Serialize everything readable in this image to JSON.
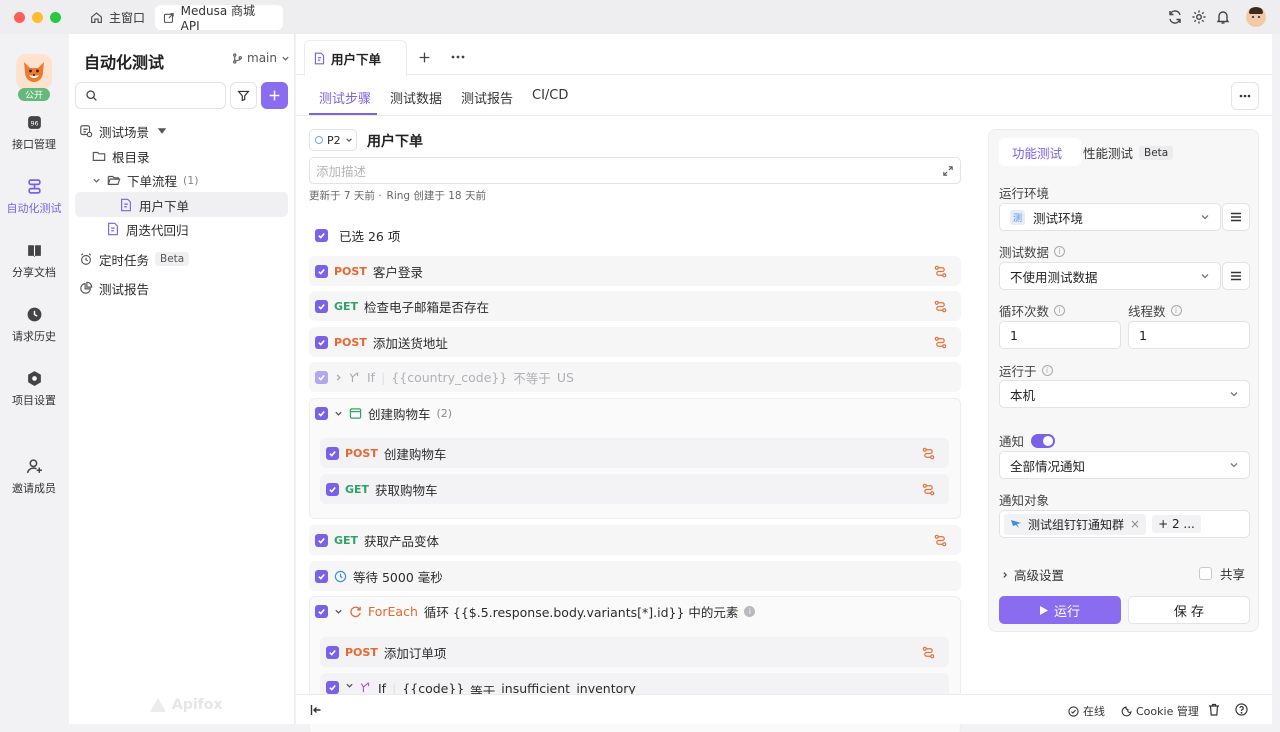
{
  "titlebar": {
    "home_tab": "主窗口",
    "project_tab": "Medusa 商城 API"
  },
  "rail": {
    "badge": "公开",
    "items": [
      {
        "label": "接口管理",
        "icon": "api-icon"
      },
      {
        "label": "自动化测试",
        "icon": "automation-icon"
      },
      {
        "label": "分享文档",
        "icon": "book-icon"
      },
      {
        "label": "请求历史",
        "icon": "history-icon"
      },
      {
        "label": "项目设置",
        "icon": "settings-icon"
      },
      {
        "label": "邀请成员",
        "icon": "add-user-icon"
      }
    ],
    "brand": "Apifox"
  },
  "sidebar": {
    "title": "自动化测试",
    "branch": "main",
    "tree": {
      "scenarios": "测试场景",
      "root": "根目录",
      "order_flow": "下单流程",
      "order_flow_count": "(1)",
      "user_order": "用户下单",
      "weekly": "周迭代回归",
      "scheduled": "定时任务",
      "scheduled_badge": "Beta",
      "reports": "测试报告"
    }
  },
  "doc_tab": {
    "label": "用户下单"
  },
  "subtabs": [
    "测试步骤",
    "测试数据",
    "测试报告",
    "CI/CD"
  ],
  "scenario": {
    "priority": "P2",
    "name": "用户下单",
    "desc_placeholder": "添加描述",
    "meta_updated": "更新于 7 天前 ·",
    "meta_created": "Ring 创建于 18 天前",
    "selected": "已选 26 项"
  },
  "steps": {
    "s1": {
      "method": "POST",
      "name": "客户登录"
    },
    "s2": {
      "method": "GET",
      "name": "检查电子邮箱是否存在"
    },
    "s3": {
      "method": "POST",
      "name": "添加送货地址"
    },
    "s4": {
      "kw": "If",
      "var": "{{country_code}}",
      "op": "不等于",
      "val": "US"
    },
    "s5": {
      "name": "创建购物车",
      "count": "(2)"
    },
    "s5a": {
      "method": "POST",
      "name": "创建购物车"
    },
    "s5b": {
      "method": "GET",
      "name": "获取购物车"
    },
    "s6": {
      "method": "GET",
      "name": "获取产品变体"
    },
    "s7": {
      "name": "等待 5000 毫秒"
    },
    "s8": {
      "kw": "ForEach",
      "name": "循环 {{$.5.response.body.variants[*].id}} 中的元素"
    },
    "s8a": {
      "method": "POST",
      "name": "添加订单项"
    },
    "s8b": {
      "kw": "If",
      "var": "{{code}}",
      "op": "等于",
      "val": "insufficient_inventory"
    }
  },
  "panel": {
    "tab_functional": "功能测试",
    "tab_performance": "性能测试",
    "tab_performance_badge": "Beta",
    "env_label": "运行环境",
    "env_tag": "测",
    "env_value": "测试环境",
    "data_label": "测试数据",
    "data_value": "不使用测试数据",
    "loop_label": "循环次数",
    "loop_value": "1",
    "thread_label": "线程数",
    "thread_value": "1",
    "runon_label": "运行于",
    "runon_value": "本机",
    "notify_label": "通知",
    "notify_enabled": true,
    "notify_value": "全部情况通知",
    "target_label": "通知对象",
    "target_chip": "测试组钉钉通知群",
    "target_more": "+ 2 ...",
    "advanced": "高级设置",
    "share": "共享",
    "run": "运行",
    "save": "保 存"
  },
  "footer": {
    "online": "在线",
    "cookie": "Cookie 管理"
  },
  "colors": {
    "accent": "#7b61e8",
    "post": "#e8672e",
    "get": "#2fa366"
  }
}
